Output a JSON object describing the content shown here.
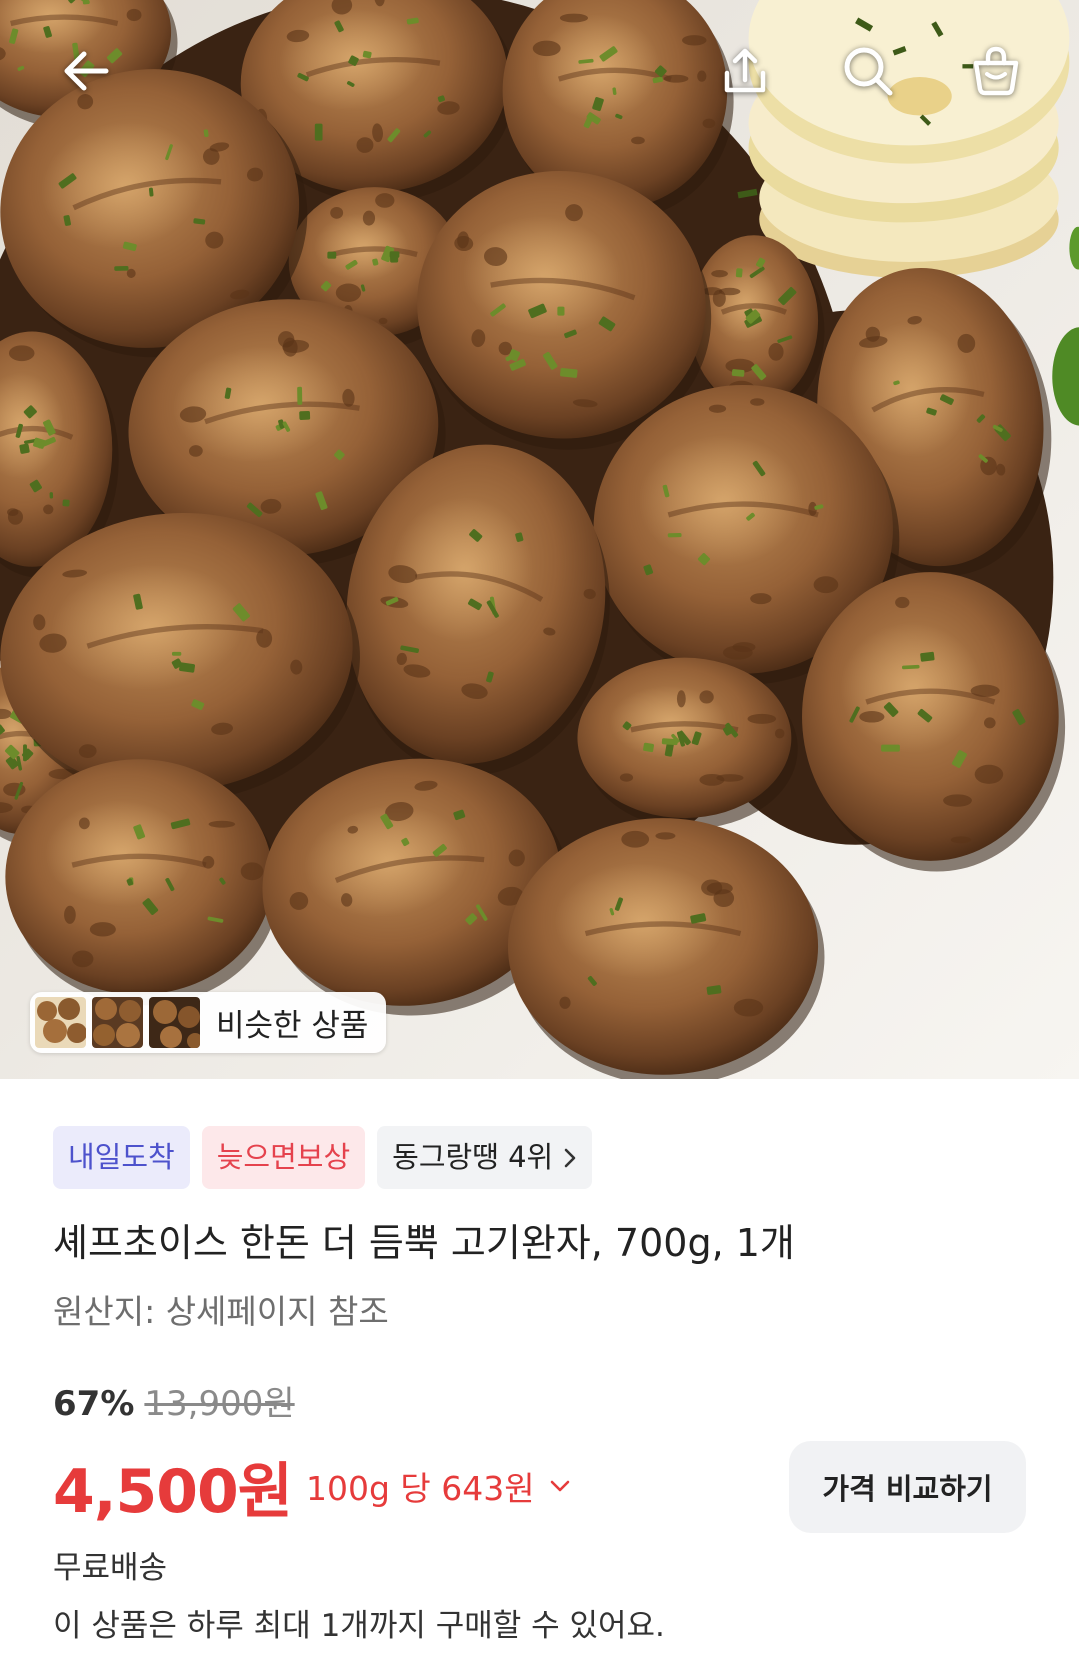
{
  "header": {
    "back_icon": "arrow-left-icon",
    "share_icon": "share-icon",
    "search_icon": "search-icon",
    "cart_icon": "shopping-bag-icon"
  },
  "gallery": {
    "similar_products_label": "비슷한 상품"
  },
  "badges": {
    "delivery": "내일도착",
    "compensation": "늦으면보상",
    "ranking": "동그랑땡 4위"
  },
  "product": {
    "title": "셰프초이스 한돈 더 듬뿍 고기완자, 700g, 1개",
    "origin": "원산지: 상세페이지 참조",
    "discount_rate": "67%",
    "original_price": "13,900원",
    "price": "4,500원",
    "unit_price": "100g 당 643원",
    "compare_button": "가격 비교하기",
    "shipping": "무료배송",
    "purchase_limit": "이 상품은 하루 최대 1개까지 구매할 수 있어요."
  },
  "colors": {
    "price_red": "#e63b3b",
    "badge_delivery_bg": "#ebebfb",
    "badge_delivery_text": "#4d52cc",
    "badge_comp_bg": "#fde8ea",
    "badge_comp_text": "#e5424d",
    "badge_rank_bg": "#f2f3f5",
    "text_primary": "#222222",
    "text_secondary": "#6e6e6e"
  }
}
